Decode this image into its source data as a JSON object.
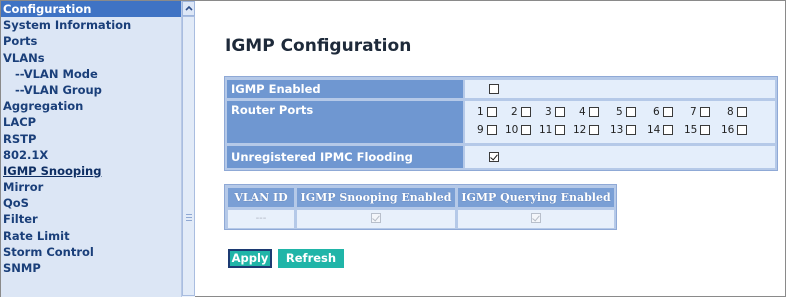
{
  "nav": {
    "items": [
      {
        "label": "Configuration"
      },
      {
        "label": "System Information"
      },
      {
        "label": "Ports"
      },
      {
        "label": "VLANs"
      },
      {
        "label": "--VLAN Mode"
      },
      {
        "label": "--VLAN Group"
      },
      {
        "label": "Aggregation"
      },
      {
        "label": "LACP"
      },
      {
        "label": "RSTP"
      },
      {
        "label": "802.1X"
      },
      {
        "label": "IGMP Snooping"
      },
      {
        "label": "Mirror"
      },
      {
        "label": "QoS"
      },
      {
        "label": "Filter"
      },
      {
        "label": "Rate Limit"
      },
      {
        "label": "Storm Control"
      },
      {
        "label": "SNMP"
      }
    ],
    "current": "IGMP Snooping"
  },
  "page": {
    "title": "IGMP Configuration"
  },
  "igmp": {
    "enabled_label": "IGMP Enabled",
    "enabled": false,
    "router_ports_label": "Router Ports",
    "ports": [
      {
        "num": "1",
        "checked": false
      },
      {
        "num": "2",
        "checked": false
      },
      {
        "num": "3",
        "checked": false
      },
      {
        "num": "4",
        "checked": false
      },
      {
        "num": "5",
        "checked": false
      },
      {
        "num": "6",
        "checked": false
      },
      {
        "num": "7",
        "checked": false
      },
      {
        "num": "8",
        "checked": false
      },
      {
        "num": "9",
        "checked": false
      },
      {
        "num": "10",
        "checked": false
      },
      {
        "num": "11",
        "checked": false
      },
      {
        "num": "12",
        "checked": false
      },
      {
        "num": "13",
        "checked": false
      },
      {
        "num": "14",
        "checked": false
      },
      {
        "num": "15",
        "checked": false
      },
      {
        "num": "16",
        "checked": false
      }
    ],
    "flooding_label": "Unregistered IPMC Flooding enabled",
    "flooding_enabled": true
  },
  "vlan_table": {
    "headers": [
      "VLAN ID",
      "IGMP Snooping Enabled",
      "IGMP Querying Enabled"
    ],
    "row": {
      "vlan_id": "---",
      "snooping_enabled": true,
      "querying_enabled": true
    }
  },
  "buttons": {
    "apply": "Apply",
    "refresh": "Refresh"
  },
  "colors": {
    "accent": "#20b5a8",
    "nav_header": "#3f73c4",
    "label_bg": "#6f97d1"
  }
}
